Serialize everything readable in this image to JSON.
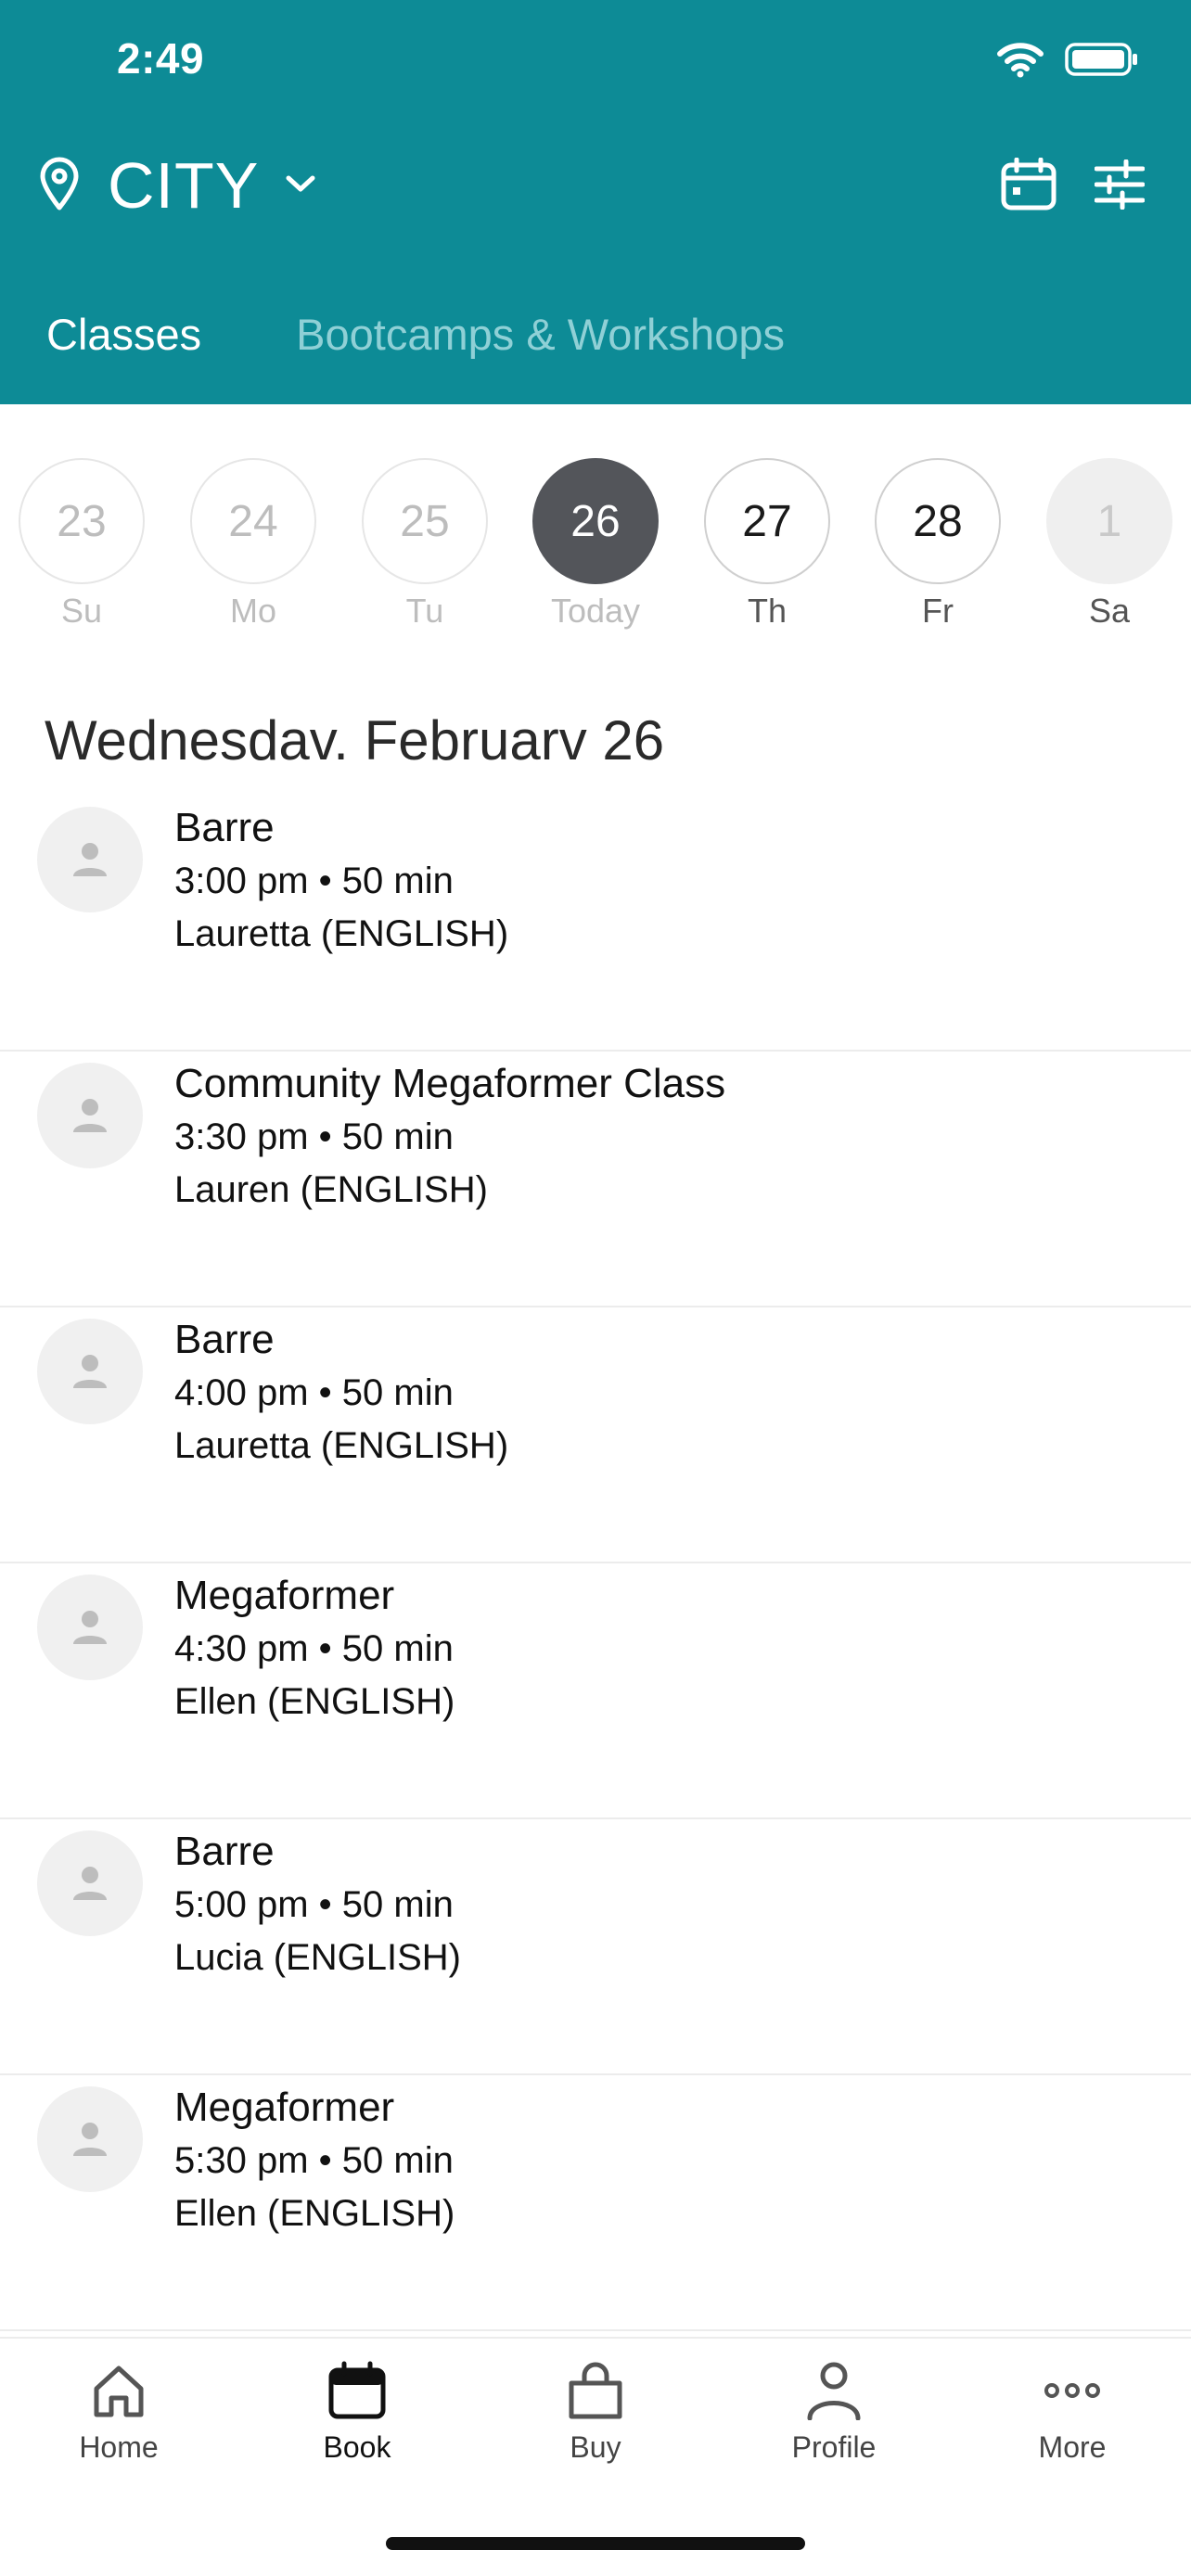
{
  "status_bar": {
    "time": "2:49"
  },
  "header": {
    "location": "CITY",
    "tabs": [
      {
        "label": "Classes",
        "active": true
      },
      {
        "label": "Bootcamps & Workshops",
        "active": false
      }
    ]
  },
  "date_strip": {
    "days": [
      {
        "num": "23",
        "label": "Su",
        "state": "past"
      },
      {
        "num": "24",
        "label": "Mo",
        "state": "past"
      },
      {
        "num": "25",
        "label": "Tu",
        "state": "past"
      },
      {
        "num": "26",
        "label": "Today",
        "state": "today"
      },
      {
        "num": "27",
        "label": "Th",
        "state": "future"
      },
      {
        "num": "28",
        "label": "Fr",
        "state": "future"
      },
      {
        "num": "1",
        "label": "Sa",
        "state": "unavailable"
      }
    ]
  },
  "schedule": {
    "date_heading": "Wednesdav. Februarv 26",
    "classes": [
      {
        "name": "Barre",
        "time": "3:00 pm • 50 min",
        "instructor": "Lauretta (ENGLISH)"
      },
      {
        "name": "Community Megaformer Class",
        "time": "3:30 pm • 50 min",
        "instructor": "Lauren (ENGLISH)"
      },
      {
        "name": "Barre",
        "time": "4:00 pm • 50 min",
        "instructor": "Lauretta (ENGLISH)"
      },
      {
        "name": "Megaformer",
        "time": "4:30 pm • 50 min",
        "instructor": "Ellen (ENGLISH)"
      },
      {
        "name": "Barre",
        "time": "5:00 pm • 50 min",
        "instructor": "Lucia (ENGLISH)"
      },
      {
        "name": "Megaformer",
        "time": "5:30 pm • 50 min",
        "instructor": "Ellen (ENGLISH)"
      }
    ]
  },
  "bottom_nav": {
    "items": [
      {
        "label": "Home",
        "icon": "home-icon"
      },
      {
        "label": "Book",
        "icon": "calendar-icon",
        "active": true
      },
      {
        "label": "Buy",
        "icon": "bag-icon"
      },
      {
        "label": "Profile",
        "icon": "person-icon"
      },
      {
        "label": "More",
        "icon": "more-icon"
      }
    ]
  },
  "colors": {
    "header_bg": "#0d8b96",
    "tab_inactive": "#8fd0d6",
    "today_circle": "#53555a"
  }
}
